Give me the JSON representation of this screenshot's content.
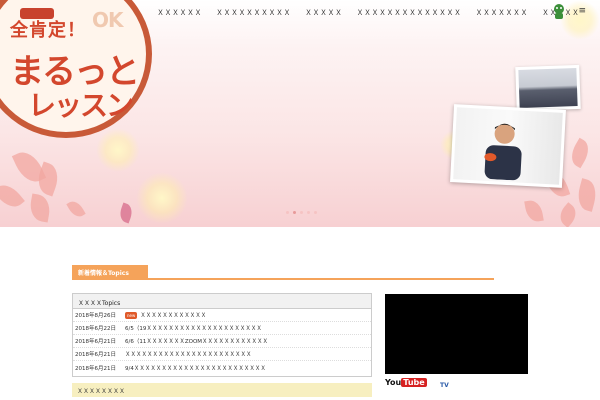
{
  "nav": {
    "items": [
      "ＸＸＸＸＸＸ",
      "ＸＸＸＸＸＸＸＸＸＸ",
      "ＸＸＸＸＸ",
      "ＸＸＸＸＸＸＸＸＸＸＸＸＸＸ",
      "ＸＸＸＸＸＸＸ",
      "ＸＸＸＸＸ"
    ],
    "menu_icon": "≡"
  },
  "hero": {
    "logo_top": "全肯定！",
    "logo_ok": "OK",
    "logo_main": "まるっと",
    "logo_sub": "レッスン"
  },
  "topics": {
    "tab_label": "新着情報＆Topics",
    "box_title": "ＸＸＸＸTopics",
    "new_badge": "new",
    "rows": [
      {
        "date": "2018年8月26日",
        "title": "ＸＸＸＸＸＸＸＸＸＸＸＸ",
        "is_new": true
      },
      {
        "date": "2018年6月22日",
        "title": "6/5（19ＸＸＸＸＸＸＸＸＸＸＸＸＸＸＸＸＸＸＸＸＸ",
        "is_new": false
      },
      {
        "date": "2018年6月21日",
        "title": "6/6（11ＸＸＸＸＸＸＸZOOMＸＸＸＸＸＸＸＸＸＸＸＸ",
        "is_new": false
      },
      {
        "date": "2018年6月21日",
        "title": "ＸＸＸＸＸＸＸＸＸＸＸＸＸＸＸＸＸＸＸＸＸＸＸ",
        "is_new": false
      },
      {
        "date": "2018年6月21日",
        "title": "9/4ＸＸＸＸＸＸＸＸＸＸＸＸＸＸＸＸＸＸＸＸＸＸＸＸ",
        "is_new": false
      }
    ],
    "sub_tab": "ＸＸＸＸＸＸＸＸ"
  },
  "media": {
    "youtube_you": "You",
    "youtube_tube": "Tube",
    "tv_label": "TV"
  },
  "colors": {
    "accent": "#f5a35a",
    "logo_red": "#d3472d"
  }
}
